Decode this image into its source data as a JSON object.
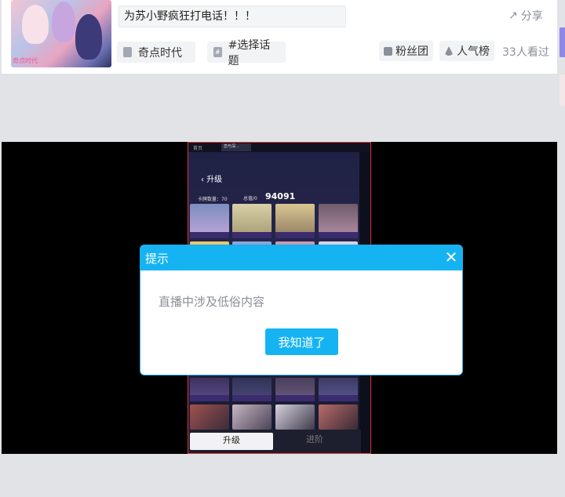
{
  "header": {
    "cover_tag": "奇点时代",
    "title": "为苏小野疯狂打电话！！！",
    "share_label": "分享",
    "category_tag": "奇点时代",
    "topic_tag": "#选择话题",
    "fans_label": "粉丝团",
    "ranking_label": "人气榜",
    "viewers": "33人看过"
  },
  "stream": {
    "tab_home": "首页",
    "tab_game": "恋与深…",
    "page_title": "升级",
    "card_count_label": "卡牌数量：70",
    "total_label": "总值/0",
    "score": "94091",
    "bottom_tab_upgrade": "升级",
    "bottom_tab_advance": "进阶"
  },
  "modal": {
    "title": "提示",
    "message": "直播中涉及低俗内容",
    "confirm_label": "我知道了",
    "close_icon": "close-icon"
  },
  "colors": {
    "accent": "#16b3f3",
    "edge_purple": "#8f86e9"
  }
}
